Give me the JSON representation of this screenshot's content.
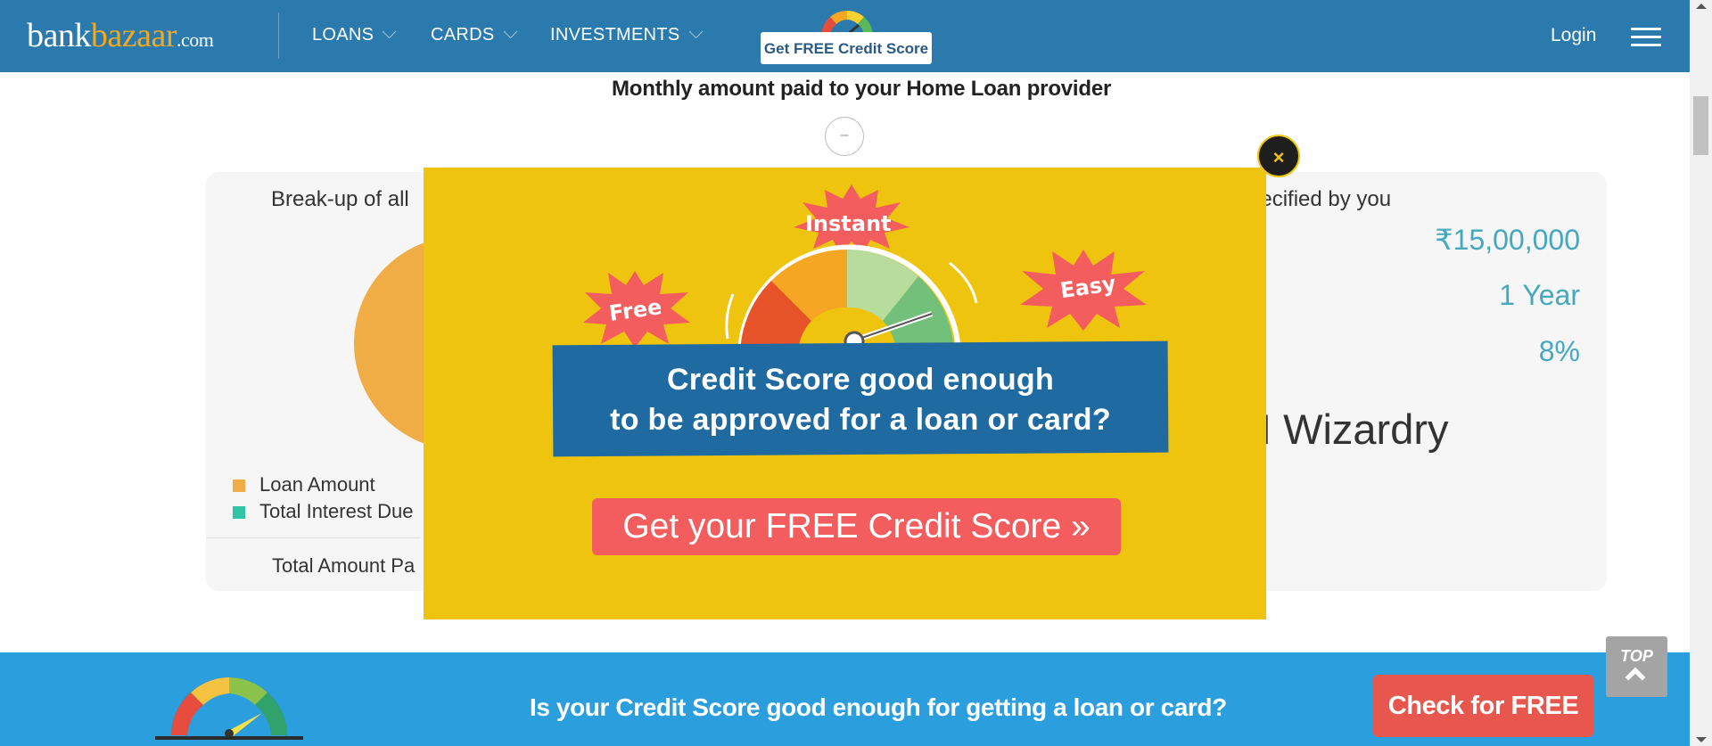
{
  "header": {
    "logo": {
      "part1": "bank",
      "part2": "bazaar",
      "suffix": ".com"
    },
    "nav": [
      {
        "label": "LOANS"
      },
      {
        "label": "CARDS"
      },
      {
        "label": "INVESTMENTS"
      }
    ],
    "credit_button": "Get FREE Credit Score",
    "login": "Login"
  },
  "page": {
    "monthly_label": "Monthly amount paid to your Home Loan provider",
    "minus_symbol": "–",
    "breakup_label": "Break-up of all",
    "specified_label": "pecified by you",
    "legend": [
      {
        "label": "Loan Amount",
        "color": "#f0ad45"
      },
      {
        "label": "Total Interest Due",
        "color": "#2ec4a5"
      }
    ],
    "total_label": "Total Amount Pa",
    "values": {
      "loan_amount": "₹15,00,000",
      "tenure": "1 Year",
      "rate": "8%"
    },
    "wizardry": "I Wizardry"
  },
  "modal": {
    "close_symbol": "×",
    "bursts": {
      "free": "Free",
      "instant": "Instant",
      "easy": "Easy"
    },
    "headline_line1": "Credit Score good enough",
    "headline_line2": "to be approved for a loan or card?",
    "cta": "Get your FREE Credit Score »"
  },
  "bottom_bar": {
    "question": "Is your Credit Score good enough for getting a loan or card?",
    "cta": "Check for FREE"
  },
  "top_button": {
    "label": "TOP"
  },
  "colors": {
    "header": "#2a7aae",
    "brand_orange": "#f3a81e",
    "modal_bg": "#efc40f",
    "banner_blue": "#1f6aa1",
    "cta_red": "#f35d5d",
    "bottom_bar": "#2b9ede",
    "value_teal": "#45a8bf"
  }
}
